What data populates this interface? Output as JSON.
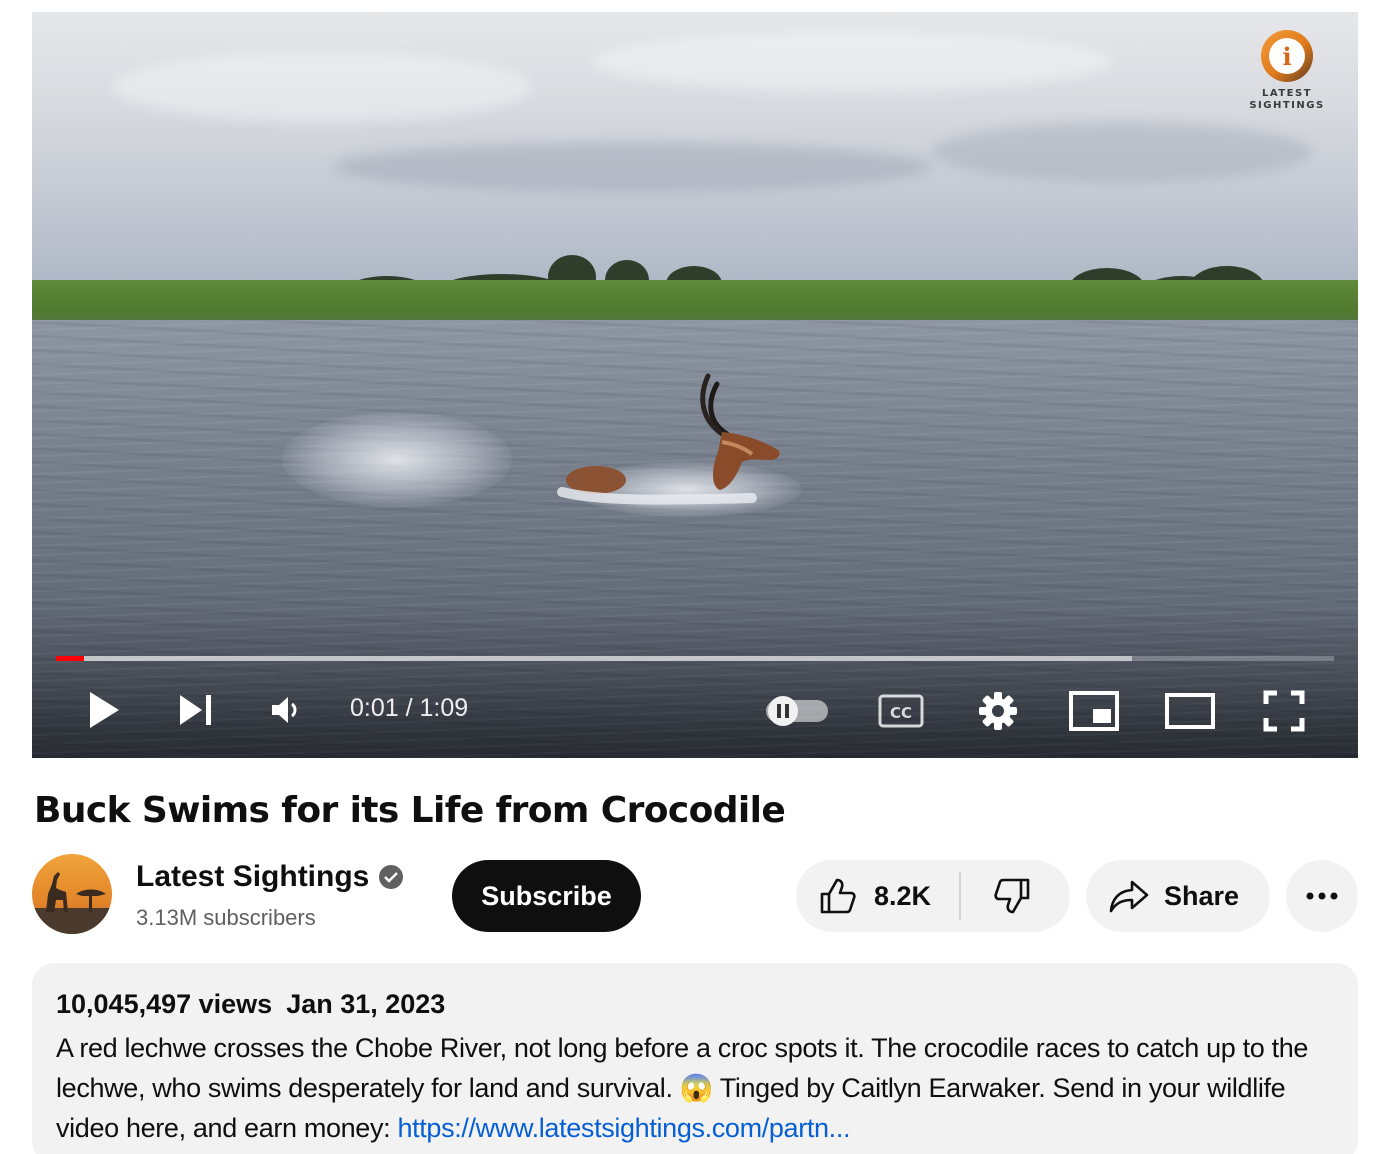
{
  "player": {
    "watermark_text_1": "LATEST",
    "watermark_text_2": "SIGHTINGS",
    "watermark_letter": "i",
    "time_current": "0:01",
    "time_separator": " / ",
    "time_total": "1:09",
    "progress_played_fraction": 0.022,
    "progress_buffered_fraction": 0.842,
    "autoplay_state": "paused-toggle-off",
    "cc_label": "CC",
    "icons": [
      "play-icon",
      "next-icon",
      "volume-icon",
      "autoplay-toggle-icon",
      "captions-icon",
      "settings-icon",
      "miniplayer-icon",
      "theater-mode-icon",
      "fullscreen-icon"
    ]
  },
  "video": {
    "title": "Buck Swims for its Life from Crocodile"
  },
  "channel": {
    "name": "Latest Sightings",
    "subscribers": "3.13M subscribers",
    "verified": true,
    "subscribe_label": "Subscribe"
  },
  "actions": {
    "like_count": "8.2K",
    "share_label": "Share",
    "more_label": "..."
  },
  "description": {
    "views": "10,045,497 views",
    "date": "Jan 31, 2023",
    "text_before_emoji": "A red lechwe crosses the Chobe River, not long before a croc spots it. The crocodile races to catch up to the lechwe, who swims desperately for land and survival. ",
    "emoji": "😱",
    "text_after_emoji": " Tinged by Caitlyn Earwaker. Send in your wildlife video here, and earn money: ",
    "link_text": "https://www.latestsightings.com/partn..."
  },
  "colors": {
    "progress_played": "#ff0000",
    "subscribe_bg": "#0f0f0f",
    "pill_bg": "#f2f2f2",
    "link": "#065fd4",
    "secondary_text": "#606060"
  }
}
